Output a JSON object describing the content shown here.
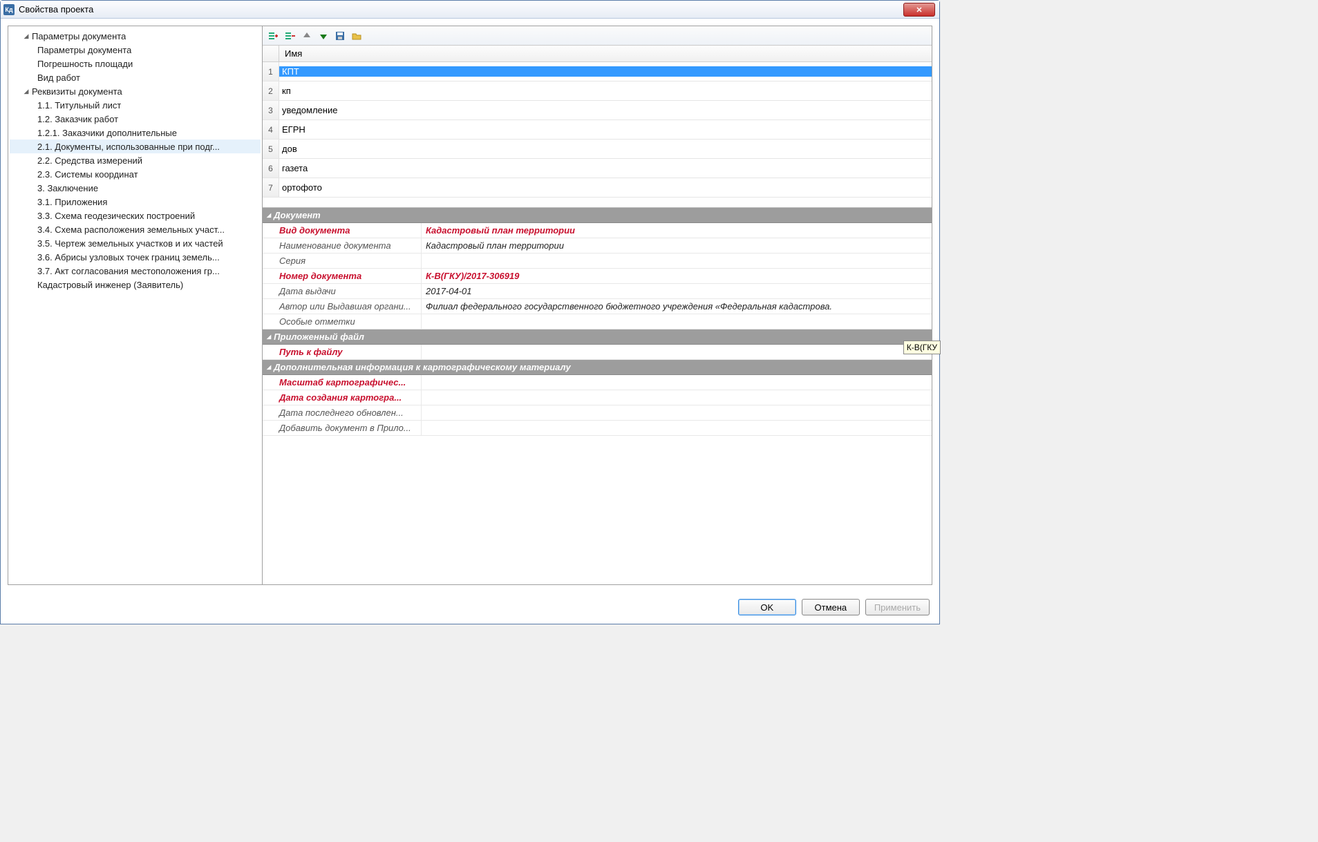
{
  "window": {
    "title": "Свойства проекта",
    "icon_text": "Кд"
  },
  "tree": {
    "group1": {
      "label": "Параметры документа",
      "items": [
        "Параметры документа",
        "Погрешность площади",
        "Вид работ"
      ]
    },
    "group2": {
      "label": "Реквизиты документа",
      "items": [
        "1.1. Титульный лист",
        "1.2. Заказчик работ",
        "1.2.1. Заказчики дополнительные",
        "2.1. Документы, использованные при подг...",
        "2.2. Средства измерений",
        "2.3. Системы координат",
        "3. Заключение",
        "3.1. Приложения",
        "3.3. Схема геодезических построений",
        "3.4. Схема расположения земельных участ...",
        "3.5. Чертеж земельных участков и их частей",
        "3.6. Абрисы узловых точек границ земель...",
        "3.7. Акт согласования местоположения гр...",
        "Кадастровый инженер (Заявитель)"
      ]
    }
  },
  "list": {
    "header": "Имя",
    "items": [
      "КПТ",
      "кп",
      "уведомление",
      "ЕГРН",
      "дов",
      "газета",
      "ортофото"
    ]
  },
  "groups": {
    "g1": "Документ",
    "g2": "Приложенный файл",
    "g3": "Дополнительная информация к картографическому материалу"
  },
  "props": {
    "doc_type_label": "Вид документа",
    "doc_type_value": "Кадастровый план территории",
    "doc_name_label": "Наименование документа",
    "doc_name_value": "Кадастровый план территории",
    "series_label": "Серия",
    "series_value": "",
    "doc_num_label": "Номер документа",
    "doc_num_value": "К-В(ГКУ)/2017-306919",
    "issue_date_label": "Дата выдачи",
    "issue_date_value": "2017-04-01",
    "author_label": "Автор или Выдавшая органи...",
    "author_value": "Филиал федерального государственного бюджетного учреждения «Федеральная кадастрова.",
    "special_label": "Особые отметки",
    "special_value": "",
    "file_path_label": "Путь к файлу",
    "file_path_value": "",
    "scale_label": "Масштаб картографичес...",
    "scale_value": "",
    "create_date_label": "Дата создания картогра...",
    "create_date_value": "",
    "update_date_label": "Дата последнего обновлен...",
    "update_date_value": "",
    "add_attach_label": "Добавить документ в Прило...",
    "add_attach_value": ""
  },
  "buttons": {
    "ok": "OK",
    "cancel": "Отмена",
    "apply": "Применить"
  },
  "tooltip": "К-В(ГКУ"
}
